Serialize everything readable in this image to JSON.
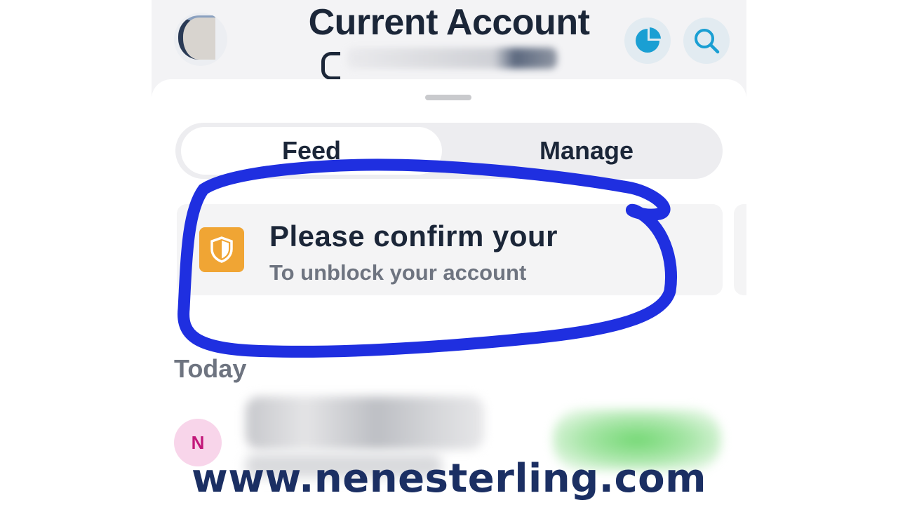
{
  "header": {
    "title": "Current Account",
    "left_avatar_icon": "profile-avatar",
    "analytics_icon": "pie-chart-icon",
    "search_icon": "search-icon",
    "icon_color": "#1a9fd3"
  },
  "tabs": [
    {
      "label": "Feed",
      "selected": true
    },
    {
      "label": "Manage",
      "selected": false
    }
  ],
  "alert": {
    "title": "Please confirm your",
    "subtitle": "To unblock your account",
    "icon": "shield-icon",
    "icon_color": "#f0a534"
  },
  "feed": {
    "section_label": "Today",
    "transactions": [
      {
        "avatar_initial": "N",
        "avatar_color": "#f8d5ea"
      }
    ]
  },
  "annotation_color": "#1f2fe0",
  "watermark": "www.nenesterling.com"
}
